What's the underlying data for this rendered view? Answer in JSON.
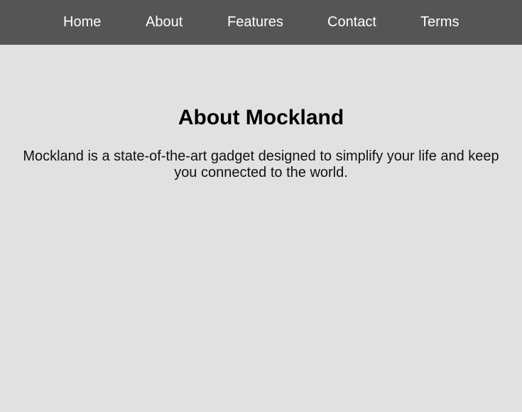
{
  "nav": {
    "items": [
      {
        "label": "Home"
      },
      {
        "label": "About"
      },
      {
        "label": "Features"
      },
      {
        "label": "Contact"
      },
      {
        "label": "Terms"
      }
    ]
  },
  "main": {
    "title": "About Mockland",
    "description": "Mockland is a state-of-the-art gadget designed to simplify your life and keep you connected to the world."
  },
  "colors": {
    "navbar_background": "#555555",
    "page_background": "#e1e1e1",
    "nav_text": "#ffffff"
  }
}
